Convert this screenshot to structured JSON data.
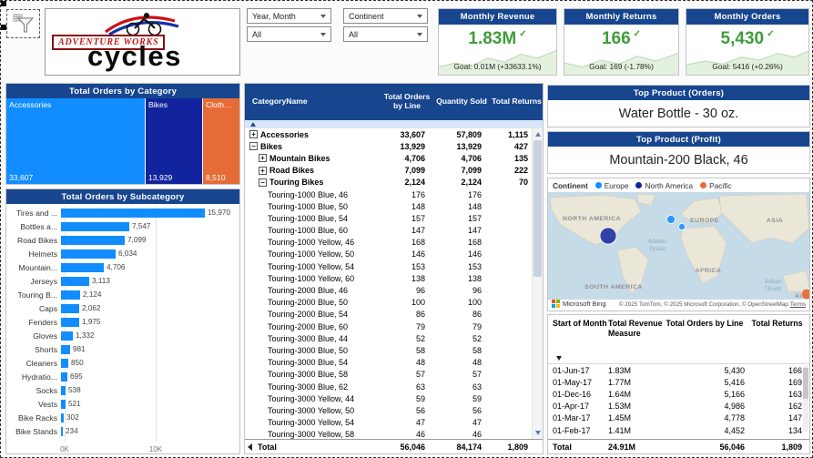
{
  "colors": {
    "header_blue": "#17468F",
    "accent_blue": "#118DFF",
    "navy": "#12239E",
    "orange": "#E66C37",
    "green": "#3F9C3A",
    "water": "#C6DBE8"
  },
  "header": {
    "logo": {
      "line1": "ADVENTURE WORKS",
      "line2": "cycles"
    },
    "slicers": [
      {
        "label": "Year, Month",
        "value": "All"
      },
      {
        "label": "Continent",
        "value": "All"
      }
    ],
    "kpis": [
      {
        "title": "Monthly Revenue",
        "value": "1.83M",
        "check": "✓",
        "goal": "Goal: 0.01M (+33633.1%)"
      },
      {
        "title": "Monthly Returns",
        "value": "166",
        "check": "✓",
        "goal": "Goal: 169 (-1.78%)"
      },
      {
        "title": "Monthly Orders",
        "value": "5,430",
        "check": "✓",
        "goal": "Goal: 5416 (+0.26%)"
      }
    ]
  },
  "category_treemap": {
    "title": "Total Orders by Category",
    "items": [
      {
        "label": "Accessories",
        "value": "33,607",
        "color": "#118DFF"
      },
      {
        "label": "Bikes",
        "value": "13,929",
        "color": "#12239E"
      },
      {
        "label": "Clothing",
        "value": "8,510",
        "color": "#E66C37"
      }
    ]
  },
  "chart_data": {
    "type": "bar",
    "orientation": "horizontal",
    "title": "Total Orders by Subcategory",
    "categories": [
      "Tires and ...",
      "Bottles a...",
      "Road Bikes",
      "Helmets",
      "Mountain...",
      "Jerseys",
      "Touring B...",
      "Caps",
      "Fenders",
      "Gloves",
      "Shorts",
      "Cleaners",
      "Hydratio...",
      "Socks",
      "Vests",
      "Bike Racks",
      "Bike Stands"
    ],
    "values": [
      15970,
      7547,
      7099,
      6034,
      4706,
      3113,
      2124,
      2062,
      1975,
      1332,
      981,
      850,
      695,
      538,
      521,
      302,
      234
    ],
    "value_labels": [
      "15,970",
      "7,547",
      "7,099",
      "6,034",
      "4,706",
      "3,113",
      "2,124",
      "2,062",
      "1,975",
      "1,332",
      "981",
      "850",
      "695",
      "538",
      "521",
      "302",
      "234"
    ],
    "x_ticks": [
      "0K",
      "10K"
    ],
    "xlim": [
      0,
      19000
    ],
    "bar_color": "#118DFF"
  },
  "matrix": {
    "columns": [
      "CategoryName",
      "Total Orders by Line",
      "Quantity Sold",
      "Total Returns"
    ],
    "rows": [
      {
        "level": 0,
        "icon": "expand",
        "name": "Accessories",
        "orders": "33,607",
        "qty": "57,809",
        "returns": "1,115",
        "bold": true
      },
      {
        "level": 0,
        "icon": "collapse",
        "name": "Bikes",
        "orders": "13,929",
        "qty": "13,929",
        "returns": "427",
        "bold": true
      },
      {
        "level": 1,
        "icon": "expand",
        "name": "Mountain Bikes",
        "orders": "4,706",
        "qty": "4,706",
        "returns": "135",
        "bold": true
      },
      {
        "level": 1,
        "icon": "expand",
        "name": "Road Bikes",
        "orders": "7,099",
        "qty": "7,099",
        "returns": "222",
        "bold": true
      },
      {
        "level": 1,
        "icon": "collapse",
        "name": "Touring Bikes",
        "orders": "2,124",
        "qty": "2,124",
        "returns": "70",
        "bold": true
      },
      {
        "level": 2,
        "icon": "",
        "name": "Touring-1000 Blue, 46",
        "orders": "176",
        "qty": "176",
        "returns": ""
      },
      {
        "level": 2,
        "icon": "",
        "name": "Touring-1000 Blue, 50",
        "orders": "148",
        "qty": "148",
        "returns": ""
      },
      {
        "level": 2,
        "icon": "",
        "name": "Touring-1000 Blue, 54",
        "orders": "157",
        "qty": "157",
        "returns": ""
      },
      {
        "level": 2,
        "icon": "",
        "name": "Touring-1000 Blue, 60",
        "orders": "147",
        "qty": "147",
        "returns": ""
      },
      {
        "level": 2,
        "icon": "",
        "name": "Touring-1000 Yellow, 46",
        "orders": "168",
        "qty": "168",
        "returns": ""
      },
      {
        "level": 2,
        "icon": "",
        "name": "Touring-1000 Yellow, 50",
        "orders": "146",
        "qty": "146",
        "returns": ""
      },
      {
        "level": 2,
        "icon": "",
        "name": "Touring-1000 Yellow, 54",
        "orders": "153",
        "qty": "153",
        "returns": ""
      },
      {
        "level": 2,
        "icon": "",
        "name": "Touring-1000 Yellow, 60",
        "orders": "138",
        "qty": "138",
        "returns": ""
      },
      {
        "level": 2,
        "icon": "",
        "name": "Touring-2000 Blue, 46",
        "orders": "96",
        "qty": "96",
        "returns": ""
      },
      {
        "level": 2,
        "icon": "",
        "name": "Touring-2000 Blue, 50",
        "orders": "100",
        "qty": "100",
        "returns": ""
      },
      {
        "level": 2,
        "icon": "",
        "name": "Touring-2000 Blue, 54",
        "orders": "86",
        "qty": "86",
        "returns": ""
      },
      {
        "level": 2,
        "icon": "",
        "name": "Touring-2000 Blue, 60",
        "orders": "79",
        "qty": "79",
        "returns": ""
      },
      {
        "level": 2,
        "icon": "",
        "name": "Touring-3000 Blue, 44",
        "orders": "52",
        "qty": "52",
        "returns": ""
      },
      {
        "level": 2,
        "icon": "",
        "name": "Touring-3000 Blue, 50",
        "orders": "58",
        "qty": "58",
        "returns": ""
      },
      {
        "level": 2,
        "icon": "",
        "name": "Touring-3000 Blue, 54",
        "orders": "48",
        "qty": "48",
        "returns": ""
      },
      {
        "level": 2,
        "icon": "",
        "name": "Touring-3000 Blue, 58",
        "orders": "57",
        "qty": "57",
        "returns": ""
      },
      {
        "level": 2,
        "icon": "",
        "name": "Touring-3000 Blue, 62",
        "orders": "63",
        "qty": "63",
        "returns": ""
      },
      {
        "level": 2,
        "icon": "",
        "name": "Touring-3000 Yellow, 44",
        "orders": "59",
        "qty": "59",
        "returns": ""
      },
      {
        "level": 2,
        "icon": "",
        "name": "Touring-3000 Yellow, 50",
        "orders": "56",
        "qty": "56",
        "returns": ""
      },
      {
        "level": 2,
        "icon": "",
        "name": "Touring-3000 Yellow, 54",
        "orders": "47",
        "qty": "47",
        "returns": ""
      },
      {
        "level": 2,
        "icon": "",
        "name": "Touring-3000 Yellow, 58",
        "orders": "46",
        "qty": "46",
        "returns": ""
      }
    ],
    "total": {
      "name": "Total",
      "orders": "56,046",
      "qty": "84,174",
      "returns": "1,809"
    }
  },
  "top_products": [
    {
      "title": "Top Product (Orders)",
      "value": "Water Bottle - 30 oz."
    },
    {
      "title": "Top Product (Profit)",
      "value": "Mountain-200 Black, 46"
    }
  ],
  "map": {
    "legend_title": "Continent",
    "legend": [
      {
        "label": "Europe",
        "color": "#118DFF"
      },
      {
        "label": "North America",
        "color": "#12239E"
      },
      {
        "label": "Pacific",
        "color": "#E66C37"
      }
    ],
    "labels": {
      "north_america": "NORTH AMERICA",
      "south_america": "SOUTH AMERICA",
      "europe": "EUROPE",
      "africa": "AFRICA",
      "asia": "ASIA",
      "aus": "AUS",
      "atlantic1": "Atlantic",
      "atlantic2": "Ocean",
      "indian1": "Indian",
      "indian2": "Ocean"
    },
    "bing": "Microsoft Bing",
    "attribution": "© 2025 TomTom, © 2025 Microsoft Corporation, © OpenStreetMap",
    "terms": "Terms"
  },
  "month_table": {
    "columns": [
      "Start of Month",
      "Total Revenue Measure",
      "Total Orders by Line",
      "Total Returns"
    ],
    "rows": [
      {
        "month": "01-Jun-17",
        "revenue": "1.83M",
        "orders": "5,430",
        "returns": "166"
      },
      {
        "month": "01-May-17",
        "revenue": "1.77M",
        "orders": "5,416",
        "returns": "169"
      },
      {
        "month": "01-Dec-16",
        "revenue": "1.64M",
        "orders": "5,166",
        "returns": "163"
      },
      {
        "month": "01-Apr-17",
        "revenue": "1.53M",
        "orders": "4,986",
        "returns": "162"
      },
      {
        "month": "01-Mar-17",
        "revenue": "1.45M",
        "orders": "4,778",
        "returns": "147"
      },
      {
        "month": "01-Feb-17",
        "revenue": "1.41M",
        "orders": "4,452",
        "returns": "134"
      }
    ],
    "total": {
      "month": "Total",
      "revenue": "24.91M",
      "orders": "56,046",
      "returns": "1,809"
    }
  }
}
